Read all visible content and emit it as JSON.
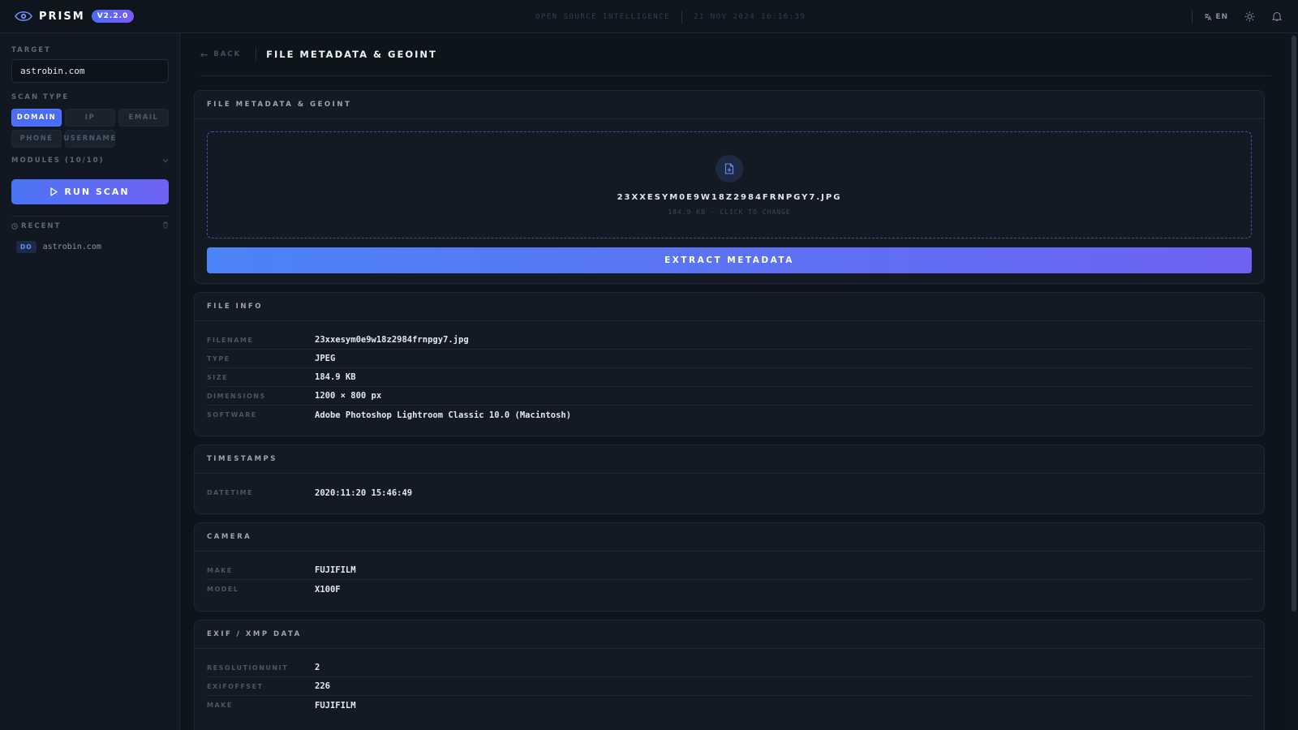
{
  "app": {
    "name": "PRISM",
    "version": "V2.2.0",
    "header_center_left": "Open Source Intelligence",
    "header_center_right": "21 Nov 2024 16:16:39",
    "lang": "EN"
  },
  "sidebar": {
    "target_label": "TARGET",
    "target_value": "astrobin.com",
    "scan_type_label": "SCAN TYPE",
    "scan_types": [
      {
        "label": "DOMAIN",
        "active": true
      },
      {
        "label": "IP",
        "active": false
      },
      {
        "label": "EMAIL",
        "active": false
      },
      {
        "label": "PHONE",
        "active": false
      },
      {
        "label": "USERNAME",
        "active": false
      }
    ],
    "modules_label": "MODULES (10/10)",
    "run_scan_label": "RUN SCAN",
    "recent_label": "RECENT",
    "recent_items": [
      {
        "tag": "DO",
        "text": "astrobin.com"
      }
    ]
  },
  "main": {
    "back_label": "BACK",
    "page_title": "FILE METADATA & GEOINT",
    "upload_card": {
      "title": "FILE METADATA & GEOINT",
      "file_name": "23xxesym0e9w18z2984frnpgy7.jpg",
      "file_sub": "184.9 KB · Click to change",
      "extract_label": "EXTRACT METADATA"
    },
    "file_info": {
      "title": "FILE INFO",
      "rows": [
        {
          "k": "FILENAME",
          "v": "23xxesym0e9w18z2984frnpgy7.jpg"
        },
        {
          "k": "TYPE",
          "v": "JPEG"
        },
        {
          "k": "SIZE",
          "v": "184.9 KB"
        },
        {
          "k": "DIMENSIONS",
          "v": "1200 × 800 px"
        },
        {
          "k": "SOFTWARE",
          "v": "Adobe Photoshop Lightroom Classic 10.0 (Macintosh)"
        }
      ]
    },
    "timestamps": {
      "title": "TIMESTAMPS",
      "rows": [
        {
          "k": "DATETIME",
          "v": "2020:11:20 15:46:49"
        }
      ]
    },
    "camera": {
      "title": "CAMERA",
      "rows": [
        {
          "k": "MAKE",
          "v": "FUJIFILM"
        },
        {
          "k": "MODEL",
          "v": "X100F"
        }
      ]
    },
    "exif": {
      "title": "EXIF / XMP DATA",
      "rows": [
        {
          "k": "RESOLUTIONUNIT",
          "v": "2"
        },
        {
          "k": "EXIFOFFSET",
          "v": "226"
        },
        {
          "k": "MAKE",
          "v": "FUJIFILM"
        }
      ]
    }
  },
  "colors": {
    "accent": "#4a6cf7",
    "accent_purple": "#6d62f2",
    "background": "#0e141c",
    "card": "#131a24"
  },
  "icons": [
    "eye-logo-icon",
    "translate-icon",
    "sun-icon",
    "bell-icon",
    "chevron-down-icon",
    "play-icon",
    "clock-icon",
    "trash-icon",
    "file-plus-icon",
    "back-arrow-icon"
  ]
}
